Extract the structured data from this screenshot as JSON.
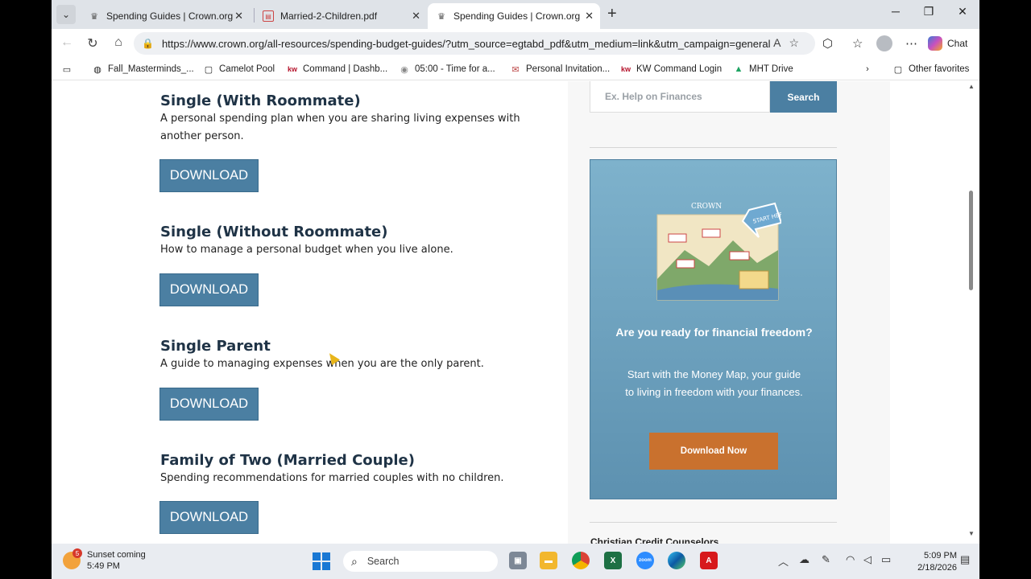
{
  "browser": {
    "tabs": [
      {
        "label": "Spending Guides | Crown.org"
      },
      {
        "label": "Married-2-Children.pdf"
      },
      {
        "label": "Spending Guides | Crown.org"
      }
    ],
    "url": "https://www.crown.org/all-resources/spending-budget-guides/?utm_source=egtabd_pdf&utm_medium=link&utm_campaign=general",
    "chat_label": "Chat",
    "bookmarks": [
      {
        "label": "Fall_Masterminds_..."
      },
      {
        "label": "Camelot Pool"
      },
      {
        "label": "Command | Dashb..."
      },
      {
        "label": "05:00 - Time for a..."
      },
      {
        "label": "Personal Invitation..."
      },
      {
        "label": "KW Command Login"
      },
      {
        "label": "MHT Drive"
      }
    ],
    "other_favorites": "Other favorites"
  },
  "page": {
    "guides": [
      {
        "title": "Single (With Roommate)",
        "description": "A personal spending plan when you are sharing living expenses with another person.",
        "button": "DOWNLOAD"
      },
      {
        "title": "Single (Without Roommate)",
        "description": "How to manage a personal budget when you live alone.",
        "button": "DOWNLOAD"
      },
      {
        "title": "Single Parent",
        "description": "A guide to managing expenses when you are the only parent.",
        "button": "DOWNLOAD"
      },
      {
        "title": "Family of Two (Married Couple)",
        "description": "Spending recommendations for married couples with no children.",
        "button": "DOWNLOAD"
      }
    ],
    "sidebar": {
      "search_placeholder": "Ex. Help on Finances",
      "search_button": "Search",
      "promo_logo": "CROWN",
      "promo_sign": "START HERE",
      "promo_heading": "Are you ready for financial freedom?",
      "promo_text": "Start with the Money Map, your guide to living in freedom with your finances.",
      "promo_button": "Download Now",
      "next_heading": "Christian Credit Counselors"
    }
  },
  "taskbar": {
    "weather_title": "Sunset coming",
    "weather_time": "5:49 PM",
    "weather_badge": "5",
    "search_label": "Search",
    "time": "5:09 PM",
    "date": "2/18/2026"
  }
}
